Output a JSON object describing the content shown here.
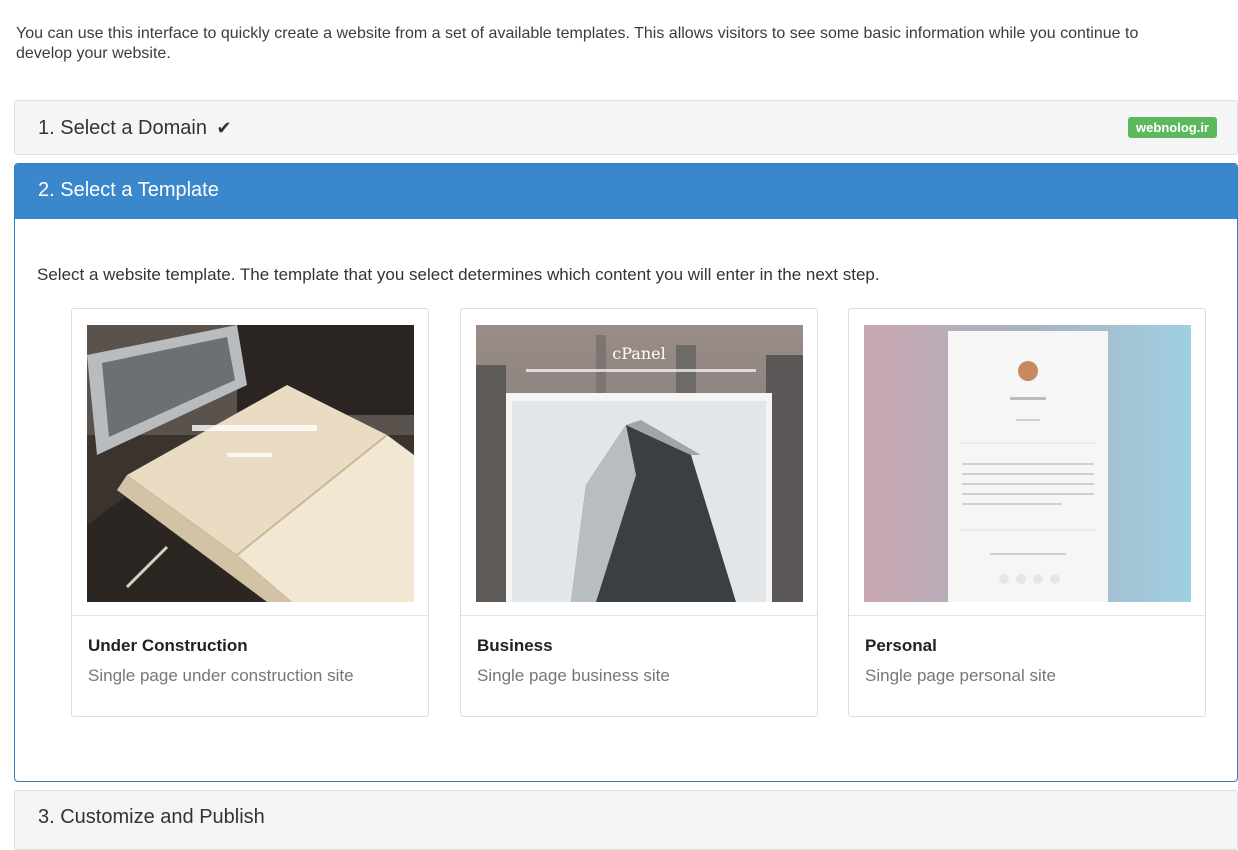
{
  "intro": "You can use this interface to quickly create a website from a set of available templates. This allows visitors to see some basic information while you continue to develop your website.",
  "step1": {
    "title": "1. Select a Domain",
    "check_icon": "checkmark-icon",
    "domain_badge": "webnolog.ir"
  },
  "step2": {
    "title": "2. Select a Template",
    "description": "Select a website template. The template that you select determines which content you will enter in the next step.",
    "templates": [
      {
        "name": "Under Construction",
        "description": "Single page under construction site"
      },
      {
        "name": "Business",
        "description": "Single page business site",
        "preview_brand": "cPanel"
      },
      {
        "name": "Personal",
        "description": "Single page personal site"
      }
    ]
  },
  "step3": {
    "title": "3. Customize and Publish"
  },
  "colors": {
    "primary": "#3a87cc",
    "badge": "#5cb85c"
  }
}
